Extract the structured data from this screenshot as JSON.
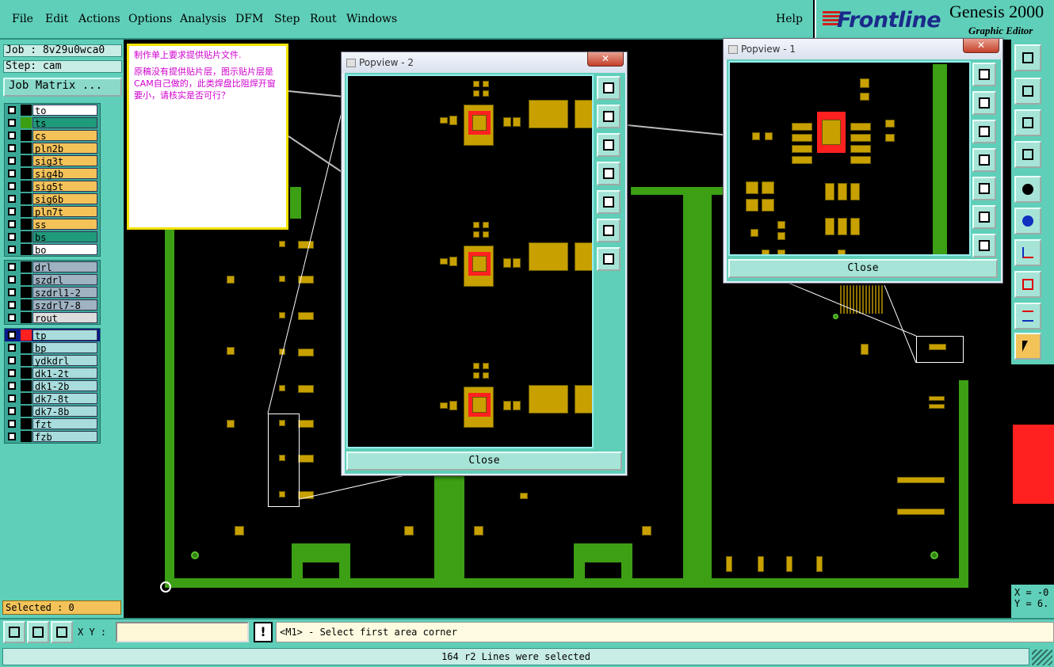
{
  "menu": [
    "File",
    "Edit",
    "Actions",
    "Options",
    "Analysis",
    "DFM",
    "Step",
    "Rout",
    "Windows"
  ],
  "help": "Help",
  "brand": {
    "name": "Frontline",
    "product": "Genesis 2000",
    "subtitle": "Graphic Editor"
  },
  "job": {
    "job": "Job : 8v29u0wca0",
    "step": "Step: cam",
    "matrix_btn": "Job Matrix ..."
  },
  "layers": {
    "board": [
      {
        "name": "to",
        "color": "#ffffff",
        "swatch": "#000000"
      },
      {
        "name": "ts",
        "color": "#1f9a7a",
        "swatch": "#3c9f14"
      },
      {
        "name": "cs",
        "color": "#f3c35a",
        "swatch": "#000000"
      },
      {
        "name": "pln2b",
        "color": "#f3c35a",
        "swatch": "#000000"
      },
      {
        "name": "sig3t",
        "color": "#f3c35a",
        "swatch": "#000000"
      },
      {
        "name": "sig4b",
        "color": "#f3c35a",
        "swatch": "#000000"
      },
      {
        "name": "sig5t",
        "color": "#f3c35a",
        "swatch": "#000000"
      },
      {
        "name": "sig6b",
        "color": "#f3c35a",
        "swatch": "#000000"
      },
      {
        "name": "pln7t",
        "color": "#f3c35a",
        "swatch": "#000000"
      },
      {
        "name": "ss",
        "color": "#f3c35a",
        "swatch": "#000000"
      },
      {
        "name": "bs",
        "color": "#1f9a7a",
        "swatch": "#000000"
      },
      {
        "name": "bo",
        "color": "#ffffff",
        "swatch": "#000000"
      }
    ],
    "drill": [
      {
        "name": "drl",
        "color": "#9fb3c2",
        "swatch": "#000000"
      },
      {
        "name": "szdrl",
        "color": "#9fb3c2",
        "swatch": "#000000"
      },
      {
        "name": "szdrl1-2",
        "color": "#9fb3c2",
        "swatch": "#000000"
      },
      {
        "name": "szdrl7-8",
        "color": "#9fb3c2",
        "swatch": "#000000"
      },
      {
        "name": "rout",
        "color": "#dcdcdc",
        "swatch": "#000000"
      }
    ],
    "misc": [
      {
        "name": "tp",
        "color": "#a9dcdc",
        "swatch": "#ff2020",
        "active": true
      },
      {
        "name": "bp",
        "color": "#a9dcdc",
        "swatch": "#000000"
      },
      {
        "name": "ydkdrl",
        "color": "#a9dcdc",
        "swatch": "#000000"
      },
      {
        "name": "dk1-2t",
        "color": "#a9dcdc",
        "swatch": "#000000"
      },
      {
        "name": "dk1-2b",
        "color": "#a9dcdc",
        "swatch": "#000000"
      },
      {
        "name": "dk7-8t",
        "color": "#a9dcdc",
        "swatch": "#000000"
      },
      {
        "name": "dk7-8b",
        "color": "#a9dcdc",
        "swatch": "#000000"
      },
      {
        "name": "fzt",
        "color": "#a9dcdc",
        "swatch": "#000000"
      },
      {
        "name": "fzb",
        "color": "#a9dcdc",
        "swatch": "#000000"
      }
    ]
  },
  "selected": "Selected : 0",
  "note": {
    "line1": "制作单上要求提供贴片文件.",
    "line2": "原稿没有提供贴片层，图示贴片层是CAM自己做的，此类焊盘比阻焊开窗要小，请核实是否可行？"
  },
  "popview2": {
    "title": "Popview - 2",
    "close": "Close"
  },
  "popview1": {
    "title": "Popview - 1",
    "close": "Close"
  },
  "coords": {
    "x": "X = -0",
    "y": "Y = 6."
  },
  "xy_label": "X Y :",
  "xy_value": "",
  "prompt": "<M1> - Select first area corner",
  "status": "164 r2 Lines were selected",
  "colors": {
    "panel": "#5fcfb9",
    "copper": "#c8a000",
    "mask": "#3c9f14",
    "highlight": "#ff2020"
  }
}
